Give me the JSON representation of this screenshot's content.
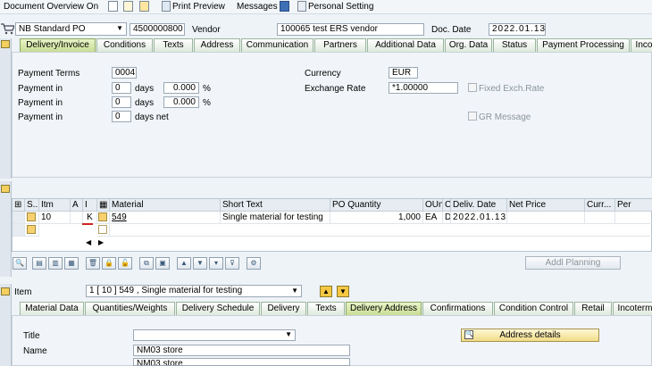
{
  "toolbar": {
    "doc_overview": "Document Overview On",
    "print_preview": "Print Preview",
    "messages": "Messages",
    "personal_setting": "Personal Setting"
  },
  "header": {
    "po_type": "NB Standard PO",
    "po_number": "4500000800",
    "vendor_label": "Vendor",
    "vendor_value": "100065 test ERS vendor",
    "doc_date_label": "Doc. Date",
    "doc_date_value": "2022.01.13"
  },
  "header_tabs": [
    "Delivery/Invoice",
    "Conditions",
    "Texts",
    "Address",
    "Communication",
    "Partners",
    "Additional Data",
    "Org. Data",
    "Status",
    "Payment Processing",
    "Inco"
  ],
  "delivery_invoice": {
    "payment_terms_label": "Payment Terms",
    "payment_terms_value": "0004",
    "payment_in_label": "Payment in",
    "row1_days": "0",
    "row1_pct": "0.000",
    "row2_days": "0",
    "row2_pct": "0.000",
    "row3_days": "0",
    "days_label": "days",
    "days_net_label": "days net",
    "pct_sign": "%",
    "currency_label": "Currency",
    "currency_value": "EUR",
    "exchange_rate_label": "Exchange Rate",
    "exchange_rate_value": "*1.00000",
    "fixed_exch_rate_label": "Fixed Exch.Rate",
    "gr_message_label": "GR Message"
  },
  "items_grid": {
    "columns": [
      "S..",
      "Itm",
      "A",
      "I",
      "",
      "Material",
      "Short Text",
      "PO Quantity",
      "OUn",
      "C",
      "Deliv. Date",
      "Net Price",
      "Curr...",
      "Per"
    ],
    "row": {
      "itm": "10",
      "a": "",
      "i": "K",
      "material": "549",
      "short_text": "Single material for testing",
      "po_quantity": "1,000",
      "oun": "EA",
      "c": "D",
      "deliv_date": "2022.01.13"
    },
    "addl_planning": "Addl Planning"
  },
  "item_section": {
    "item_label": "Item",
    "item_select": "1 [ 10 ] 549 , Single material for testing"
  },
  "item_tabs": [
    "Material Data",
    "Quantities/Weights",
    "Delivery Schedule",
    "Delivery",
    "Texts",
    "Delivery Address",
    "Confirmations",
    "Condition Control",
    "Retail",
    "Incoterm"
  ],
  "delivery_address": {
    "title_label": "Title",
    "name_label": "Name",
    "name_value": "NM03 store",
    "name2_value": "NM03 store",
    "address_details": "Address details"
  }
}
